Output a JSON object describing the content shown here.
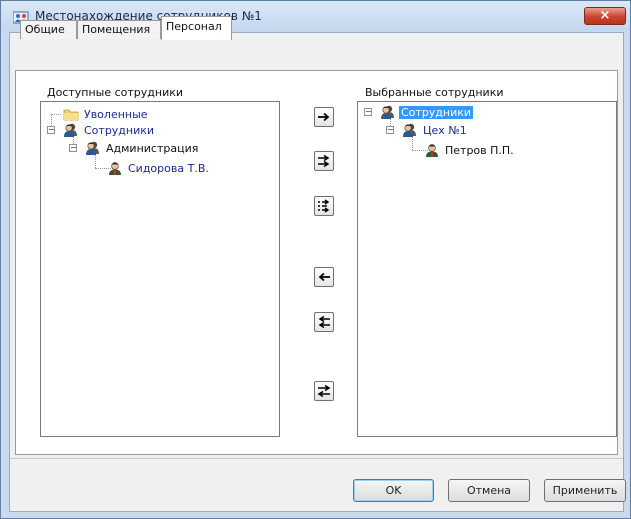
{
  "window": {
    "title": "Местонахождение сотрудников №1",
    "close_symbol": "×",
    "icon": "people-map-icon"
  },
  "tabs": [
    {
      "label": "Общие",
      "active": false
    },
    {
      "label": "Помещения",
      "active": false
    },
    {
      "label": "Персонал",
      "active": true
    }
  ],
  "available": {
    "label": "Доступные сотрудники",
    "nodes": [
      {
        "text": "Уволенные",
        "icon": "folder-icon"
      },
      {
        "text": "Сотрудники",
        "icon": "group-icon",
        "expanded": true
      },
      {
        "text": "Администрация",
        "icon": "group-icon",
        "expanded": true
      },
      {
        "text": "Сидорова Т.В.",
        "icon": "person-icon"
      }
    ]
  },
  "selected": {
    "label": "Выбранные сотрудники",
    "nodes": [
      {
        "text": "Сотрудники",
        "icon": "group-icon",
        "expanded": true,
        "selected": true
      },
      {
        "text": "Цех №1",
        "icon": "group-icon",
        "expanded": true
      },
      {
        "text": "Петров П.П.",
        "icon": "person-icon"
      }
    ]
  },
  "move_buttons": [
    {
      "icon": "arrow-right-icon",
      "action": "add selected"
    },
    {
      "icon": "double-arrow-right-icon",
      "action": "add group"
    },
    {
      "icon": "dotted-arrow-right-icon",
      "action": "add all"
    },
    {
      "icon": "arrow-left-icon",
      "action": "remove selected"
    },
    {
      "icon": "double-arrow-left-icon",
      "action": "remove all"
    },
    {
      "icon": "swap-arrows-icon",
      "action": "swap"
    }
  ],
  "footer": {
    "ok_label": "OK",
    "cancel_label": "Отмена",
    "apply_label": "Применить"
  },
  "colors": {
    "selection": "#3399ff",
    "link_text": "#1c2a8c",
    "close_button": "#c9452e"
  }
}
